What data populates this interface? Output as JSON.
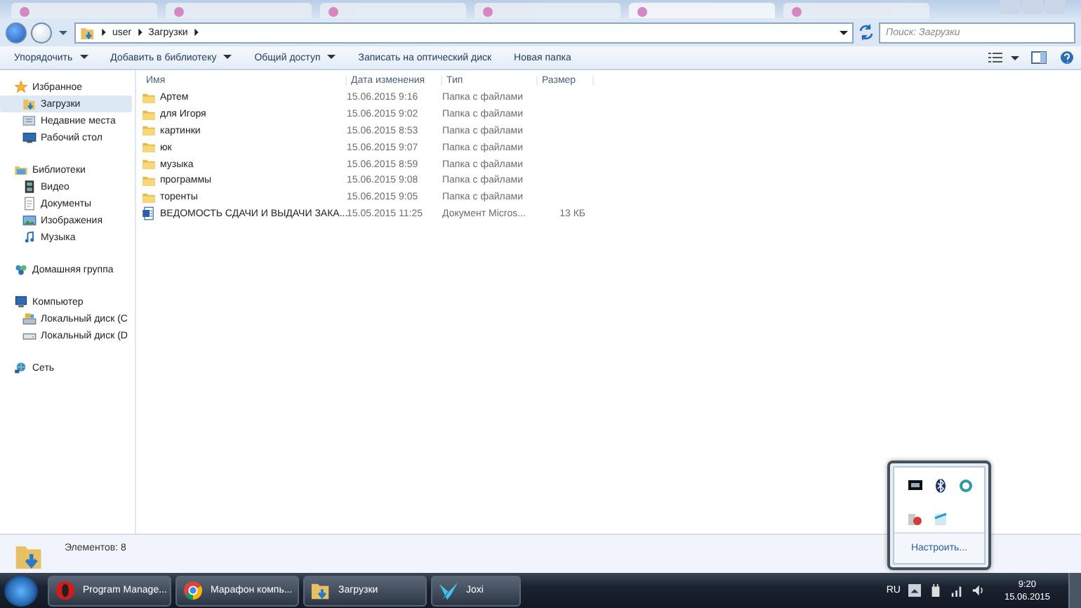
{
  "address": {
    "path": [
      "user",
      "Загрузки"
    ]
  },
  "search": {
    "placeholder": "Поиск: Загрузки"
  },
  "toolbar": [
    {
      "label": "Упорядочить",
      "dropdown": true
    },
    {
      "label": "Добавить в библиотеку",
      "dropdown": true
    },
    {
      "label": "Общий доступ",
      "dropdown": true
    },
    {
      "label": "Записать на оптический диск",
      "dropdown": false
    },
    {
      "label": "Новая папка",
      "dropdown": false
    }
  ],
  "nav": [
    {
      "label": "Избранное",
      "selected": false,
      "children": [
        {
          "label": "Загрузки",
          "selected": true
        },
        {
          "label": "Недавние места",
          "selected": false
        },
        {
          "label": "Рабочий стол",
          "selected": false
        }
      ]
    },
    {
      "label": "Библиотеки",
      "selected": false,
      "children": [
        {
          "label": "Видео",
          "selected": false
        },
        {
          "label": "Документы",
          "selected": false
        },
        {
          "label": "Изображения",
          "selected": false
        },
        {
          "label": "Музыка",
          "selected": false
        }
      ]
    },
    {
      "label": "Домашняя группа",
      "selected": false
    },
    {
      "label": "Компьютер",
      "selected": false,
      "children": [
        {
          "label": "Локальный диск (C",
          "selected": false
        },
        {
          "label": "Локальный диск (D",
          "selected": false
        }
      ]
    },
    {
      "label": "Сеть",
      "selected": false
    }
  ],
  "columns": [
    "Имя",
    "Дата изменения",
    "Тип",
    "Размер"
  ],
  "files": [
    {
      "kind": "folder",
      "name": "Артем",
      "date": "15.06.2015 9:16",
      "type": "Папка с файлами"
    },
    {
      "kind": "folder",
      "name": "для Игоря",
      "date": "15.06.2015 9:02",
      "type": "Папка с файлами"
    },
    {
      "kind": "folder",
      "name": "картинки",
      "date": "15.06.2015 8:53",
      "type": "Папка с файлами"
    },
    {
      "kind": "folder",
      "name": "юк",
      "date": "15.06.2015 9:07",
      "type": "Папка с файлами"
    },
    {
      "kind": "folder",
      "name": "музыка",
      "date": "15.06.2015 8:59",
      "type": "Папка с файлами"
    },
    {
      "kind": "folder",
      "name": "программы",
      "date": "15.06.2015 9:08",
      "type": "Папка с файлами"
    },
    {
      "kind": "folder",
      "name": "торенты",
      "date": "15.06.2015 9:05",
      "type": "Папка с файлами"
    },
    {
      "kind": "document",
      "name": "ВЕДОМОСТЬ СДАЧИ И ВЫДАЧИ ЗАКА...",
      "date": "15.05.2015 11:25",
      "type": "Документ Micros...",
      "size": "13 КБ"
    }
  ],
  "status": "Элементов: 8",
  "taskbar": [
    {
      "label": "Program Manage..."
    },
    {
      "label": "Марафон компь..."
    },
    {
      "label": "Загрузки"
    },
    {
      "label": "Joxi"
    }
  ],
  "tray": {
    "language": "RU",
    "time": "9:20",
    "date": "15.06.2015"
  },
  "tray_popup": {
    "link": "Настроить..."
  }
}
